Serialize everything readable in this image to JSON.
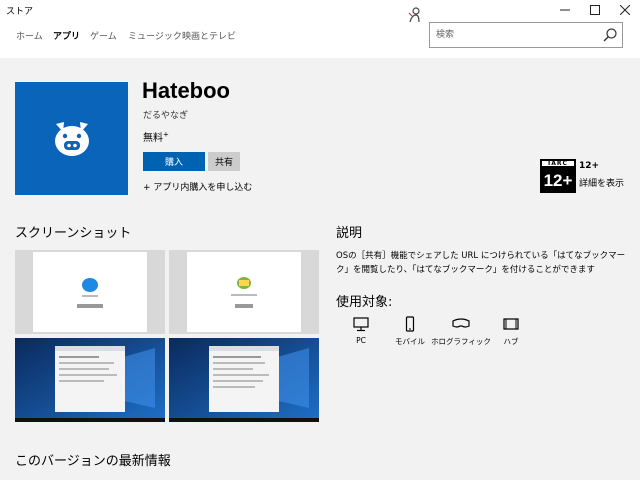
{
  "window": {
    "title": "ストア"
  },
  "nav": {
    "tabs": [
      {
        "label": "ホーム"
      },
      {
        "label": "アプリ"
      },
      {
        "label": "ゲーム"
      },
      {
        "label": "ミュージック"
      },
      {
        "label": "映画とテレビ"
      }
    ],
    "active_tab": "アプリ"
  },
  "search": {
    "placeholder": "検索",
    "value": ""
  },
  "app": {
    "name": "Hateboo",
    "publisher": "だるやなぎ",
    "price": "無料",
    "price_mark": "+",
    "buy_label": "購入",
    "share_label": "共有",
    "iap_note": "+ アプリ内購入を申し込む",
    "tile_color": "#0a64b9"
  },
  "rating": {
    "org": "IARC",
    "age": "12+",
    "age_text": "12+",
    "detail_link": "詳細を表示"
  },
  "screenshots": {
    "title": "スクリーンショット",
    "items": [
      {
        "kind": "app-window-blue-pig"
      },
      {
        "kind": "app-window-green-pig"
      },
      {
        "kind": "desktop-windows10"
      },
      {
        "kind": "desktop-windows10"
      }
    ]
  },
  "description": {
    "title": "説明",
    "text": "OSの［共有］機能でシェアした URL につけられている「はてなブックマーク」を閲覧したり、「はてなブックマーク」を付けることができます"
  },
  "targets": {
    "title": "使用対象:",
    "devices": [
      {
        "label": "PC",
        "icon": "pc-icon"
      },
      {
        "label": "モバイル",
        "icon": "mobile-icon"
      },
      {
        "label": "ホログラフィック",
        "icon": "holographic-icon"
      },
      {
        "label": "ハブ",
        "icon": "hub-icon"
      }
    ]
  },
  "whats_new": {
    "title": "このバージョンの最新情報"
  },
  "colors": {
    "accent": "#0063b1",
    "background": "#f2f2f2",
    "share_button": "#cccccc"
  }
}
